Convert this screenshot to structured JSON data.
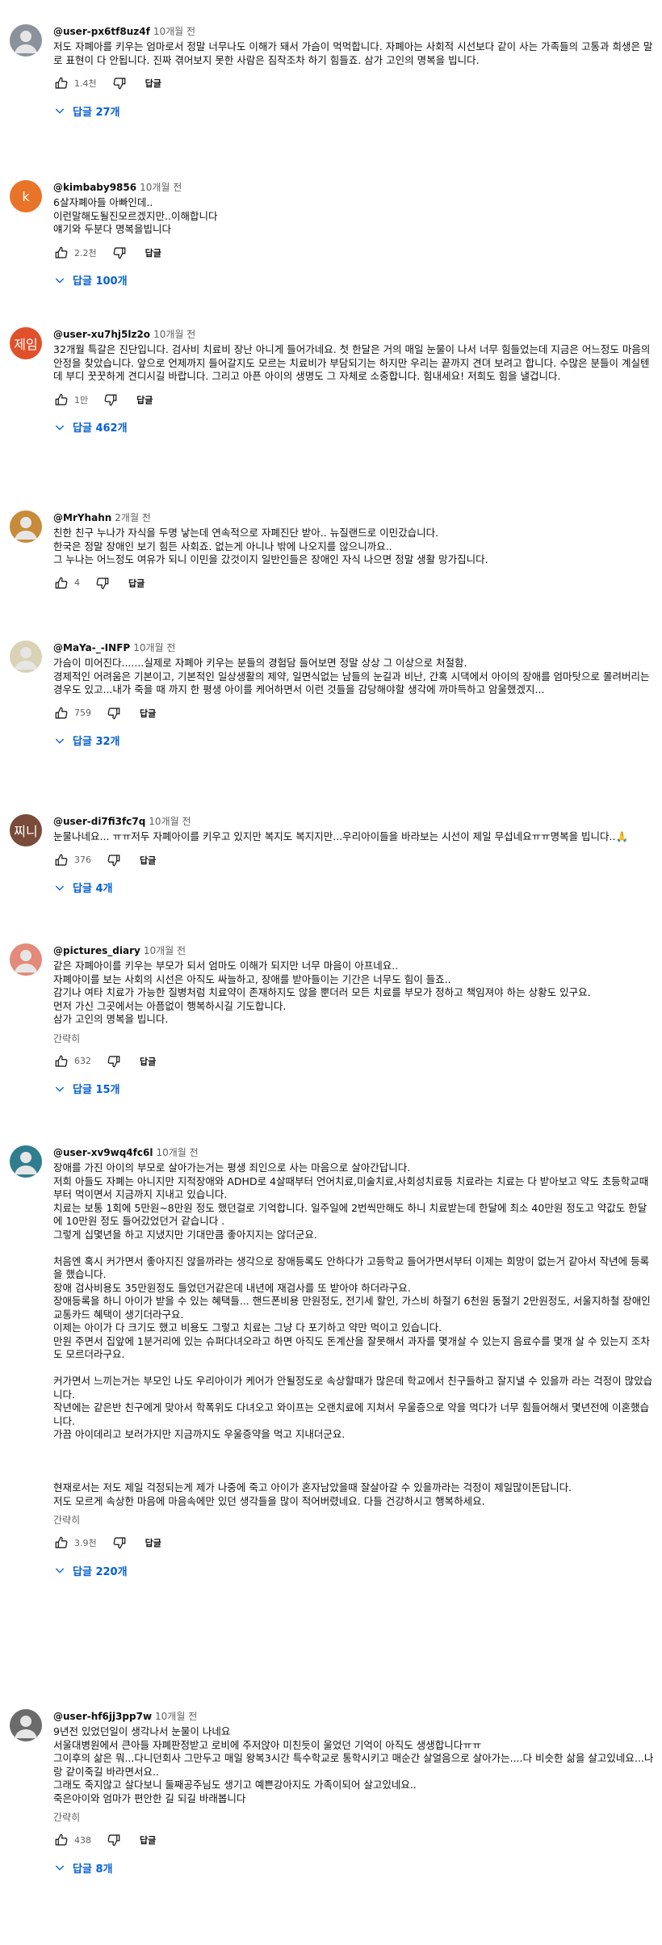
{
  "labels": {
    "reply": "답글",
    "read_more": "간략히"
  },
  "comments": [
    {
      "author": "@user-px6tf8uz4f",
      "time": "10개월 전",
      "avatar_text": "",
      "text": "저도 자폐아를 키우는 엄마로서 정말 너무나도 이해가 돼서 가슴이 먹먹합니다. 자폐아는 사회적 시선보다 같이 사는 가족들의 고통과 희생은 말로 표현이 다 안됩니다. 진짜 겪어보지 못한 사람은 짐작조차 하기 힘들죠. 삼가 고인의 명복을 빕니다.",
      "likes": "1.4천",
      "replies": "답글 27개",
      "more": ""
    },
    {
      "author": "@kimbaby9856",
      "time": "10개월 전",
      "avatar_text": "k",
      "text": "6살자폐아들 아빠인데..\n이런말해도될진모르겠지만..이해합니다\n얘기와 두분다 명복을빕니다",
      "likes": "2.2천",
      "replies": "답글 100개",
      "more": ""
    },
    {
      "author": "@user-xu7hj5lz2o",
      "time": "10개월 전",
      "avatar_text": "제임",
      "text": "32개월 특갈은 진단입니다. 검사비 치료비 장난 아니게 들어가네요. 첫 한달은 거의 매일 눈물이 나서 너무 힘들었는데 지금은 어느정도 마음의 안정을 찾았습니다. 앞으로 언제까지 들어갈지도 모르는 치료비가 부담되기는 하지만 우리는 끝까지 견뎌 보려고 합니다. 수많은 분들이 계실텐데 부디 꿋꿋하게 견디시길 바랍니다. 그리고 아픈 아이의 생명도 그 자체로 소중합니다. 힘내세요! 저희도 힘을 낼겁니다.",
      "likes": "1만",
      "replies": "답글 462개",
      "more": ""
    },
    {
      "author": "@MrYhahn",
      "time": "2개월 전",
      "avatar_text": "",
      "text": "친한 친구 누나가 자식을 두명 낳는데 연속적으로 자폐진단 받아.. 뉴질랜드로 이민갔습니다.\n한국은 정말 장애인 보기 힘든 사회죠. 없는게 아니나 밖에 나오지를 않으니까요..\n그 누나는 어느정도 여유가 되니 이민을 갔것이지 일반인들은 장애인 자식 나으면 정말 생활 망가집니다.",
      "likes": "4",
      "replies": "",
      "more": ""
    },
    {
      "author": "@MaYa-_-INFP",
      "time": "10개월 전",
      "avatar_text": "",
      "text": "가슴이 미어진다.......실제로 자폐아 키우는 분들의 경험담 들어보면 정말 상상 그 이상으로 처절함.\n경제적인 어려움은 기본이고, 기본적인 일상생활의 제약, 일면식없는 남들의 눈길과 비난, 간혹 시댁에서 아이의 장애를 엄마탓으로 몰려버리는 경우도 있고...내가 죽을 때 까지 한 평생 아이를 케어하면서 이런 것들을 감당해야할 생각에 까마득하고 암울했겠지...",
      "likes": "759",
      "replies": "답글 32개",
      "more": ""
    },
    {
      "author": "@user-di7fi3fc7q",
      "time": "10개월 전",
      "avatar_text": "찌니",
      "text": "눈물나네요... ㅠㅠ저두 자폐아이를 키우고 있지만 복지도 복지지만...우리아이들을 바라보는 시선이 제일 무섭네요ㅠㅠ명복을 빕니다..🙏",
      "likes": "376",
      "replies": "답글 4개",
      "more": ""
    },
    {
      "author": "@pictures_diary",
      "time": "10개월 전",
      "avatar_text": "",
      "text": "같은 자폐아이를 키우는 부모가 되서 엄마도 이해가 되지만 너무 마음이 아프네요..\n자폐아이를 보는 사회의 시선은 아직도 싸늘하고, 장애를 받아들이는 기간은 너무도 힘이 들죠..\n감기나 여타 치료가 가능한 질병처럼 치료약이 존재하지도 않을 뿐더러 모든 치료를 부모가 정하고 책임져야 하는 상황도 있구요.\n먼저 가신 그곳에서는 아픔없이 행복하시길 기도합니다.\n삼가 고인의 명복을 빕니다.",
      "likes": "632",
      "replies": "답글 15개",
      "more": "간략히"
    },
    {
      "author": "@user-xv9wq4fc6l",
      "time": "10개월 전",
      "avatar_text": "",
      "text": "장애를 가진 아이의 부모로 살아가는거는 평생 죄인으로 사는 마음으로 살아간답니다.\n저희 아들도 자폐는 아니지만 지적장애와 ADHD로 4살때부터 언어치료,미술치료,사회성치료등 치료라는 치료는 다 받아보고 약도 초등학교때부터 먹이면서 지금까지 지내고 있습니다.\n치료는 보통 1회에 5만원~8만원 정도 했던걸로 기억합니다. 일주일에 2번씩만해도 하니 치료받는데 한달에 최소 40만원 정도고 약값도 한달에 10만원 정도 들어갔었던거 같습니다 .\n그렇게 십몇년을 하고 지냈지만 기대만큼 좋아지지는 않더군요.\n\n처음엔 혹시 커가면서 좋아지진 않을까라는 생각으로 장애등록도 안하다가 고등학교 들어가면서부터 이제는 희망이 없는거 같아서 작년에 등록을 했습니다.\n장애 검사비용도 35만원정도 들었던거같은데 내년에 재검사를 또 받아야 하더라구요.\n장애등록을 하니 아이가 받을 수 있는 혜택들... 핸드폰비용 만원정도, 전기세 할인, 가스비 하절기 6천원 동절기 2만원정도, 서울지하철 장애인교통카드 혜택이 생기더라구요.\n이제는 아이가 다 크기도 했고 비용도 그렇고 치료는 그냥 다 포기하고 약만 먹이고 있습니다.\n만원 주면서 집앞에 1분거리에 있는 슈퍼다녀오라고 하면 아직도 돈계산을 잘못해서 과자를 몇개살 수 있는지 음료수를 몇개 살 수 있는지 조차도 모르더라구요.\n\n커가면서 느끼는거는 부모인 나도 우리아이가 케어가 안될정도로 속상할때가 많은데 학교에서 친구들하고 잘지낼 수 있을까 라는 걱정이 많았습니다.\n작년에는 같은반 친구에게 맞아서 학폭위도 다녀오고 와이프는 오랜치료에 지쳐서 우울증으로 약을 먹다가 너무 힘들어해서 몇년전에 이혼했습니다.\n가끔 아이데리고 보러가지만 지금까지도 우울증약을 먹고 지내더군요.\n\n\n\n현재로서는 저도 제일 걱정되는게 제가 나중에 죽고 아이가 혼자남았을때 잘살아갈 수 있을까라는 걱정이 제일많이돈답니다.\n저도 모르게 속상한 마음에 마음속에만 있던 생각들을 많이 적어버렸네요. 다들 건강하시고 행복하세요.",
      "likes": "3.9천",
      "replies": "답글 220개",
      "more": "간략히"
    },
    {
      "author": "@user-hf6jj3pp7w",
      "time": "10개월 전",
      "avatar_text": "",
      "text": "9년전 있었던일이 생각나서 눈물이 나네요\n서울대병원에서 큰아들 자폐판정받고 로비에 주저앉아 미친듯이 울었던 기억이 아직도 생생합니다ㅠㅠ\n그이후의 삶은 뭐...다니던회사 그만두고 매일 왕복3시간 특수학교로 통학시키고 매순간 살얼음으로 살아가는....다 비슷한 삶을 살고있네요...나랑 같이죽길 바라면서요..\n그래도 죽지않고 살다보니 둘째공주님도 생기고 예쁜강아지도 가족이되어 살고있네요..\n죽은아이와 엄마가 편안한 길 되길 바래봅니다",
      "likes": "438",
      "replies": "답글 8개",
      "more": "간략히"
    }
  ],
  "colors": {
    "link": "#065fd4",
    "secondary": "#606060",
    "text": "#0f0f0f"
  },
  "icons": [
    "thumb-up-icon",
    "thumb-down-icon",
    "chevron-down-icon"
  ]
}
